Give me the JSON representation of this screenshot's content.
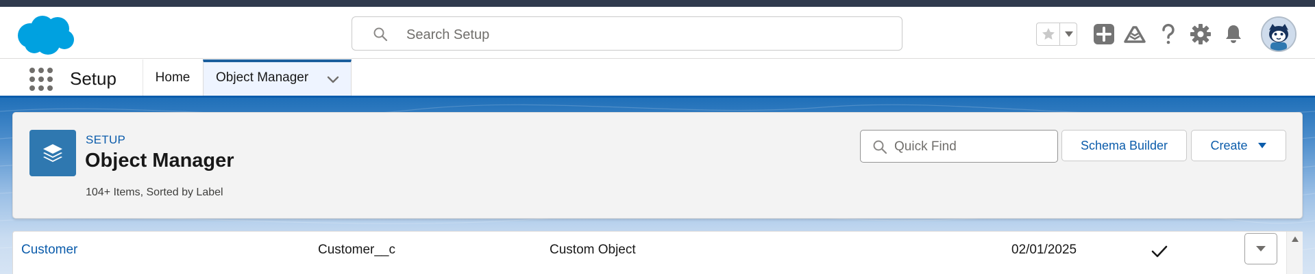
{
  "global_header": {
    "search_placeholder": "Search Setup",
    "icons": [
      "salesforce-cloud-logo",
      "search-icon",
      "favorites-star-icon",
      "favorites-dropdown-icon",
      "global-actions-icon",
      "trailhead-guidance-icon",
      "help-icon",
      "setup-gear-icon",
      "notifications-bell-icon",
      "user-avatar"
    ]
  },
  "nav": {
    "app_name": "Setup",
    "tabs": [
      {
        "label": "Home"
      },
      {
        "label": "Object Manager"
      }
    ]
  },
  "page_header": {
    "eyebrow": "SETUP",
    "title": "Object Manager",
    "meta": "104+ Items, Sorted by Label",
    "quick_find_placeholder": "Quick Find",
    "schema_builder_label": "Schema Builder",
    "create_label": "Create"
  },
  "rows": [
    {
      "label": "Customer",
      "api_name": "Customer__c",
      "type": "Custom Object",
      "last_modified": "02/01/2025",
      "deployed": true
    }
  ],
  "colors": {
    "brand_blue": "#0b5cab",
    "salesforce_cloud": "#00a1e0",
    "object_icon": "#2f78b0",
    "top_strip": "#2f3a4d"
  }
}
